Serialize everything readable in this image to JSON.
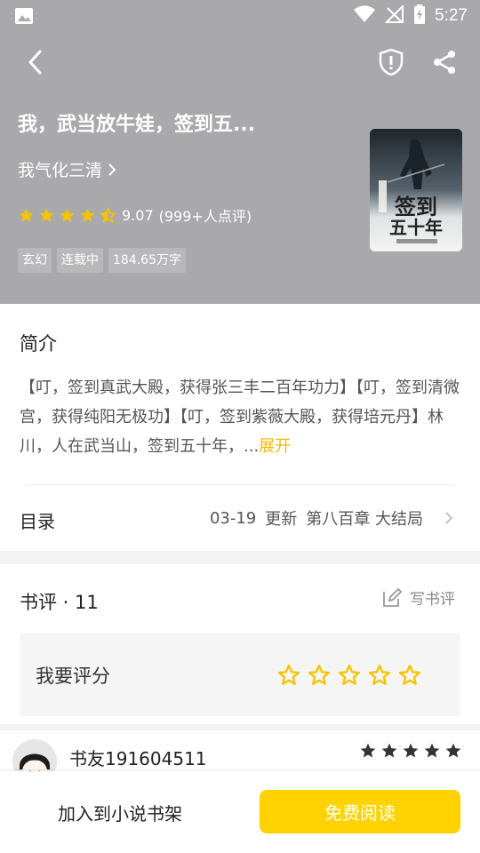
{
  "status_bar": {
    "time": "5:27"
  },
  "book": {
    "title": "我，武当放牛娃，签到五...",
    "author": "我气化三清",
    "rating": "9.07",
    "rating_count": "(999+人点评)",
    "rating_stars": 4.5,
    "tags": [
      "玄幻",
      "连载中",
      "184.65万字"
    ]
  },
  "intro": {
    "heading": "简介",
    "text": "【叮，签到真武大殿，获得张三丰二百年功力】【叮，签到清微宫，获得纯阳无极功】【叮，签到紫薇大殿，获得培元丹】林川，人在武当山，签到五十年，...",
    "expand_label": "展开"
  },
  "toc": {
    "label": "目录",
    "date": "03-19",
    "update_label": "更新",
    "latest_chapter": "第八百章 大结局"
  },
  "reviews": {
    "heading": "书评 · 11",
    "write_label": "写书评",
    "rate_prompt": "我要评分",
    "first_user": {
      "name": "书友191604511",
      "stars": 5
    }
  },
  "bottom": {
    "add_shelf_label": "加入到小说书架",
    "read_label": "免费阅读"
  },
  "colors": {
    "hero_bg": "#a9a9ab",
    "accent": "#ffd200",
    "star": "#f5c400"
  }
}
